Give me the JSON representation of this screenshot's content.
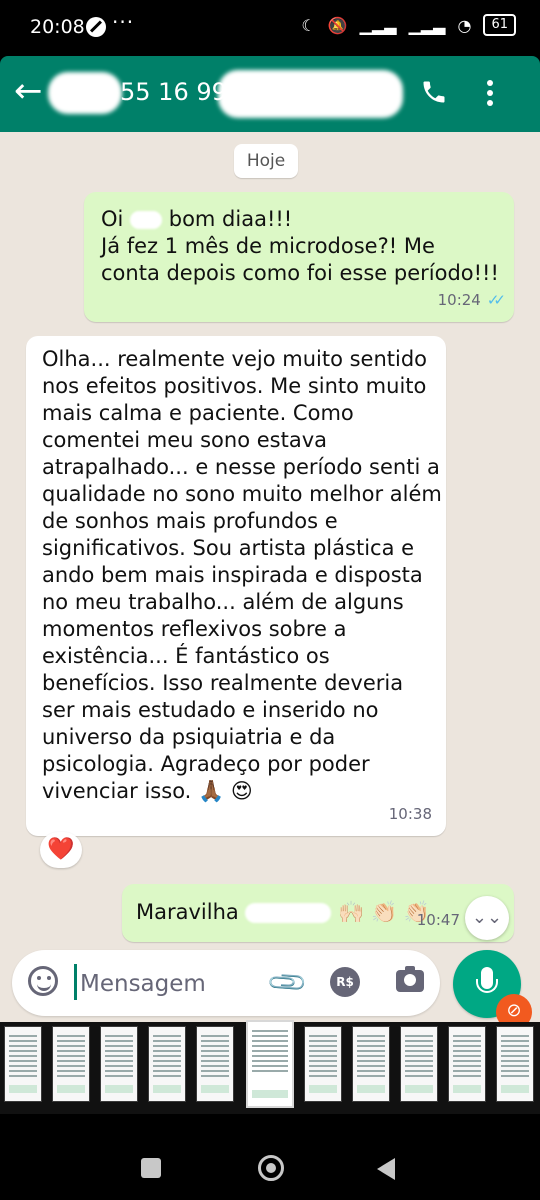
{
  "status_bar": {
    "time": "20:08",
    "more_dots": "···",
    "battery": "61"
  },
  "header": {
    "contact_name": "55 16 99",
    "back_icon": "arrow-left-icon",
    "call_icon": "phone-icon",
    "menu_icon": "more-vertical-icon",
    "color": "#008069"
  },
  "chat": {
    "date": "Hoje",
    "messages": [
      {
        "direction": "outgoing",
        "lines": [
          "Oi",
          "bom diaa!!!",
          "Já fez 1 mês de microdose?! Me",
          "conta depois como foi esse período!!!"
        ],
        "time": "10:24",
        "status": "read"
      },
      {
        "direction": "incoming",
        "lines": [
          "Olha... realmente vejo muito sentido",
          "nos efeitos positivos. Me sinto muito",
          "mais calma e paciente. Como",
          "comentei meu sono estava",
          "atrapalhado... e nesse período senti a",
          "qualidade no sono muito melhor além",
          "de sonhos mais profundos e",
          "significativos. Sou artista plástica e",
          "ando bem mais inspirada e disposta",
          "no meu trabalho... além de alguns",
          "momentos reflexivos sobre a",
          "existência... É fantástico os",
          "benefícios. Isso realmente deveria",
          "ser mais estudado e inserido no",
          "universo da psiquiatria e da",
          "psicologia. Agradeço por poder",
          "vivenciar isso. 🙏🏾 😍"
        ],
        "time": "10:38",
        "reaction": "❤️"
      },
      {
        "direction": "outgoing",
        "text": "Maravilha",
        "emojis": "🙌🏻 👏🏻 👏🏻",
        "time": "10:47"
      }
    ],
    "scroll_down_icon": "double-chevron-down-icon"
  },
  "composer": {
    "placeholder": "Mensagem",
    "emoji_icon": "emoji-icon",
    "attach_icon": "paperclip-icon",
    "payment_label": "R$",
    "camera_icon": "camera-icon",
    "mic_icon": "mic-icon"
  }
}
